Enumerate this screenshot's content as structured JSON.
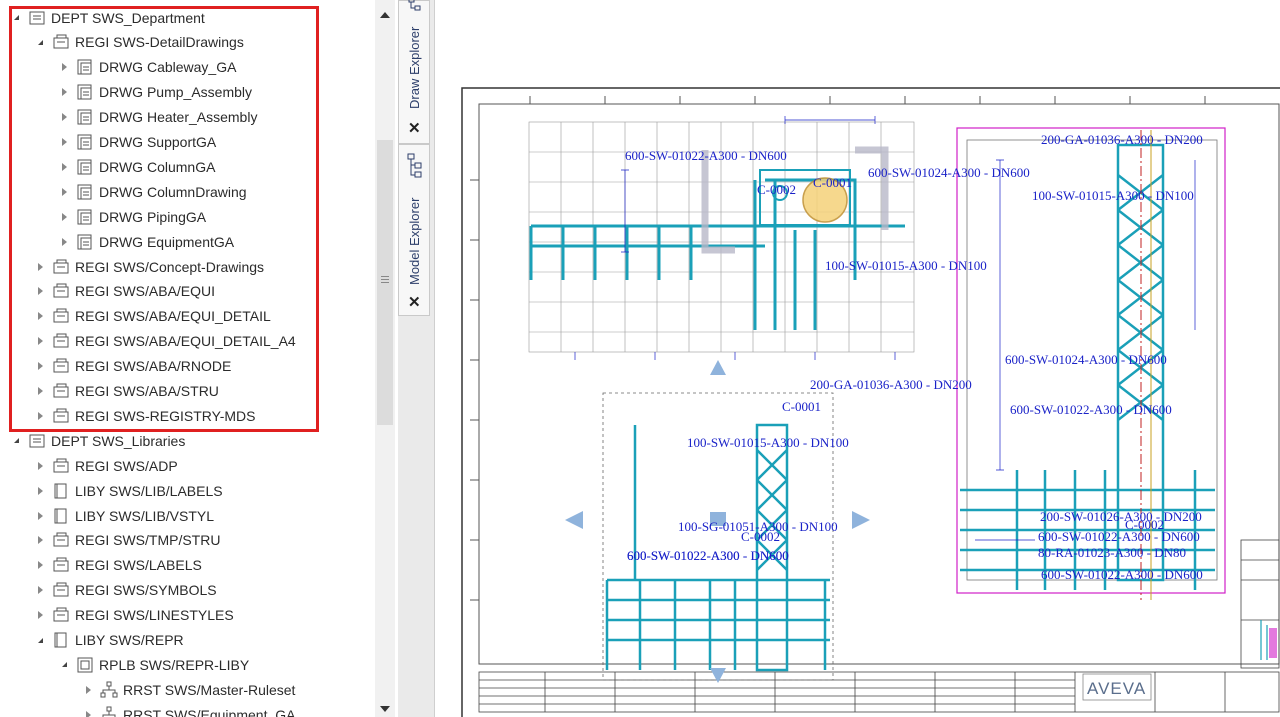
{
  "tree": {
    "rows": [
      {
        "label": "DEPT SWS_Department",
        "type": "dept",
        "expanded": true
      },
      {
        "label": "REGI SWS-DetailDrawings",
        "type": "regi",
        "expanded": true
      },
      {
        "label": "DRWG Cableway_GA",
        "type": "drwg",
        "expanded": false
      },
      {
        "label": "DRWG Pump_Assembly",
        "type": "drwg",
        "expanded": false
      },
      {
        "label": "DRWG Heater_Assembly",
        "type": "drwg",
        "expanded": false
      },
      {
        "label": "DRWG SupportGA",
        "type": "drwg",
        "expanded": false
      },
      {
        "label": "DRWG ColumnGA",
        "type": "drwg",
        "expanded": false
      },
      {
        "label": "DRWG ColumnDrawing",
        "type": "drwg",
        "expanded": false
      },
      {
        "label": "DRWG PipingGA",
        "type": "drwg",
        "expanded": false
      },
      {
        "label": "DRWG EquipmentGA",
        "type": "drwg",
        "expanded": false
      },
      {
        "label": "REGI SWS/Concept-Drawings",
        "type": "regi",
        "expanded": false
      },
      {
        "label": "REGI SWS/ABA/EQUI",
        "type": "regi",
        "expanded": false
      },
      {
        "label": "REGI SWS/ABA/EQUI_DETAIL",
        "type": "regi",
        "expanded": false
      },
      {
        "label": "REGI SWS/ABA/EQUI_DETAIL_A4",
        "type": "regi",
        "expanded": false
      },
      {
        "label": "REGI SWS/ABA/RNODE",
        "type": "regi",
        "expanded": false
      },
      {
        "label": "REGI SWS/ABA/STRU",
        "type": "regi",
        "expanded": false
      },
      {
        "label": "REGI SWS-REGISTRY-MDS",
        "type": "regi",
        "expanded": false
      },
      {
        "label": "DEPT SWS_Libraries",
        "type": "dept",
        "expanded": true
      },
      {
        "label": "REGI SWS/ADP",
        "type": "regi",
        "expanded": false
      },
      {
        "label": "LIBY SWS/LIB/LABELS",
        "type": "liby",
        "expanded": false
      },
      {
        "label": "LIBY SWS/LIB/VSTYL",
        "type": "liby",
        "expanded": false
      },
      {
        "label": "REGI SWS/TMP/STRU",
        "type": "regi",
        "expanded": false
      },
      {
        "label": "REGI SWS/LABELS",
        "type": "regi",
        "expanded": false
      },
      {
        "label": "REGI SWS/SYMBOLS",
        "type": "regi",
        "expanded": false
      },
      {
        "label": "REGI SWS/LINESTYLES",
        "type": "regi",
        "expanded": false
      },
      {
        "label": "LIBY SWS/REPR",
        "type": "liby",
        "expanded": true
      },
      {
        "label": "RPLB SWS/REPR-LIBY",
        "type": "rplb",
        "expanded": true
      },
      {
        "label": "RRST SWS/Master-Ruleset",
        "type": "rrst",
        "expanded": false
      },
      {
        "label": "RRST SWS/Equipment_GA",
        "type": "rrst",
        "expanded": false
      }
    ]
  },
  "side_tabs": {
    "draw_explorer": "Draw Explorer",
    "model_explorer": "Model Explorer",
    "close_glyph": "✕"
  },
  "drawing": {
    "labels": [
      "600-SW-01022-A300 - DN600",
      "600-SW-01024-A300 - DN600",
      "C-0002",
      "C-0001",
      "100-SW-01015-A300 - DN100",
      "200-GA-01036-A300 - DN200",
      "100-SW-01015-A300 - DN100",
      "600-SW-01024-A300 - DN600",
      "600-SW-01022-A300 - DN600",
      "200-GA-01036-A300 - DN200",
      "C-0001",
      "100-SW-01015-A300 - DN100",
      "600-SW-01022-A300 - DN600",
      "100-SG-01051-A300 - DN100",
      "C-0002",
      "600-SW-01022-A300 - DN600",
      "200-SW-01026-A300 - DN200",
      "C-0002",
      "600-SW-01022-A300 - DN600",
      "80-RA-01023-A300 - DN80",
      "600-SW-01022-A300 - DN600"
    ],
    "logo": "AVEVA"
  },
  "colors": {
    "highlight": "#e02020",
    "pipe": "#1aa0b8",
    "label": "#1a22c8",
    "magenta_frame": "#d020c8",
    "nav_arrow": "#8fb3dc"
  }
}
